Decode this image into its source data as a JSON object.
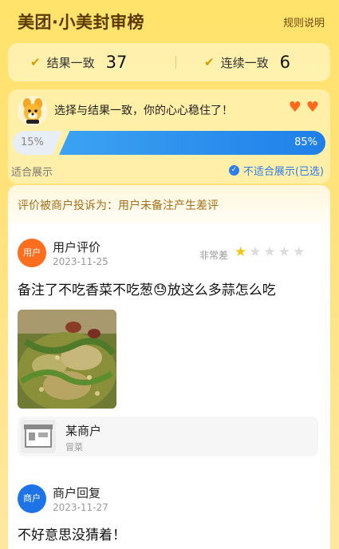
{
  "header": {
    "title": "美团·小美封审榜",
    "rules_link": "规则说明"
  },
  "scores": [
    {
      "label": "结果一致",
      "value": "37",
      "icon": "check-icon"
    },
    {
      "label": "连续一致",
      "value": "6",
      "icon": "check-icon"
    }
  ],
  "vote": {
    "message": "选择与结果一致，你的心心稳住了！",
    "hearts": 2,
    "left_percent_label": "15%",
    "right_percent_label": "85%",
    "left_percent": 15,
    "right_percent": 85,
    "left_option": "适合展示",
    "right_option": "不适合展示(已选)",
    "accent_color": "#1f7fe8"
  },
  "complaint": {
    "text": "评价被商户投诉为：用户未备注产生差评"
  },
  "review": {
    "avatar_label": "用户",
    "author": "用户评价",
    "date": "2023-11-25",
    "rating_label": "非常差",
    "rating": 1,
    "rating_max": 5,
    "text": "备注了不吃香菜不吃葱😓放这么多蒜怎么吃"
  },
  "merchant": {
    "name": "某商户",
    "category": "冒菜"
  },
  "reply": {
    "avatar_label": "商户",
    "author": "商户回复",
    "date": "2023-11-27",
    "text": "不好意思没猜着！"
  }
}
